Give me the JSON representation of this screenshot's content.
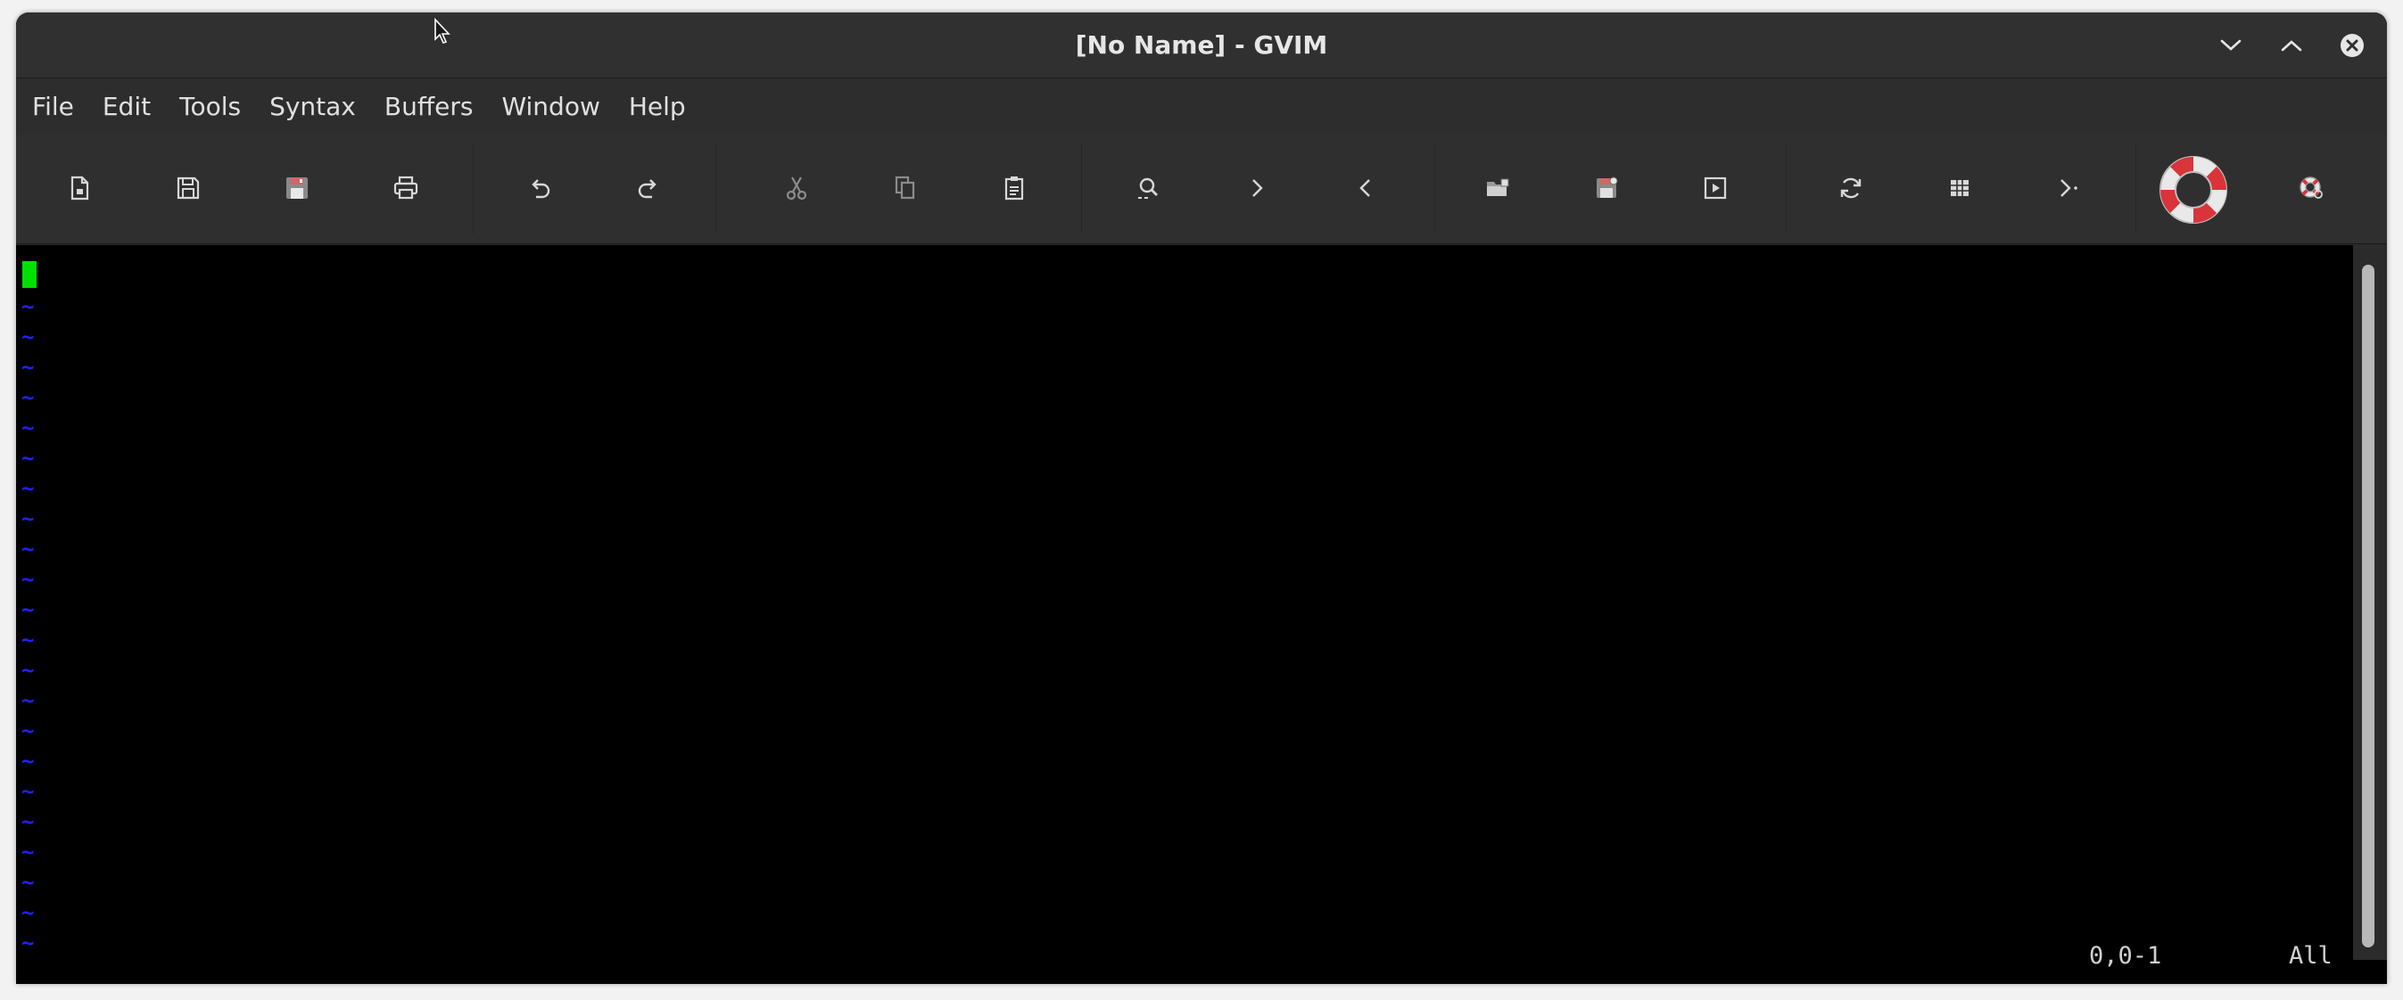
{
  "window": {
    "title": "[No Name] - GVIM"
  },
  "menu": [
    "File",
    "Edit",
    "Tools",
    "Syntax",
    "Buffers",
    "Window",
    "Help"
  ],
  "toolbar": [
    {
      "name": "new-file",
      "icon": "new-file-icon"
    },
    {
      "name": "save",
      "icon": "save-icon"
    },
    {
      "name": "save-all",
      "icon": "save-all-icon"
    },
    {
      "name": "print",
      "icon": "print-icon"
    },
    {
      "name": "undo",
      "icon": "undo-icon"
    },
    {
      "name": "redo",
      "icon": "redo-icon"
    },
    {
      "name": "cut",
      "icon": "cut-icon"
    },
    {
      "name": "copy",
      "icon": "copy-icon"
    },
    {
      "name": "paste",
      "icon": "paste-icon"
    },
    {
      "name": "find",
      "icon": "find-icon"
    },
    {
      "name": "find-next",
      "icon": "chevron-right-icon"
    },
    {
      "name": "find-previous",
      "icon": "chevron-left-icon"
    },
    {
      "name": "load-session",
      "icon": "load-session-icon"
    },
    {
      "name": "save-session",
      "icon": "save-session-icon"
    },
    {
      "name": "run-script",
      "icon": "run-script-icon"
    },
    {
      "name": "make",
      "icon": "refresh-icon"
    },
    {
      "name": "build-tags",
      "icon": "table-icon"
    },
    {
      "name": "jump-to-tag",
      "icon": "terminal-prompt-icon"
    },
    {
      "name": "help",
      "icon": "lifebuoy-icon"
    },
    {
      "name": "find-help",
      "icon": "help-search-icon"
    }
  ],
  "editor": {
    "empty_line_marker": "~",
    "status": {
      "position": "0,0-1",
      "scroll": "All"
    }
  },
  "colors": {
    "cursor": "#00e000",
    "tilde": "#2020ff",
    "background": "#000000"
  }
}
